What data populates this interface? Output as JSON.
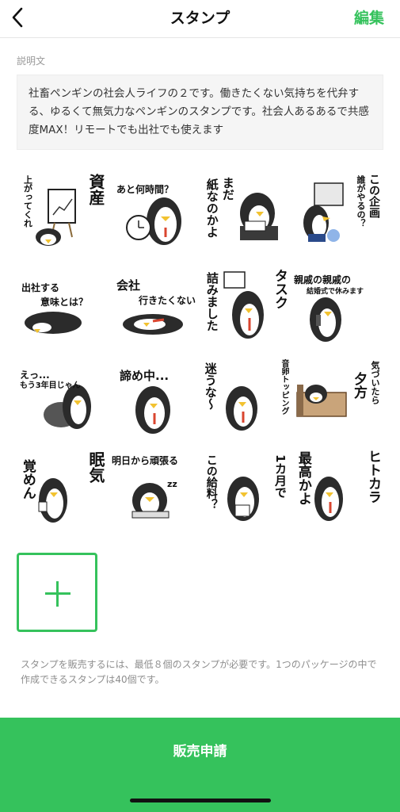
{
  "nav": {
    "title": "スタンプ",
    "edit_label": "編集",
    "back_icon": "chevron-left-icon"
  },
  "description": {
    "label": "説明文",
    "text": "社畜ペンギンの社会人ライフの２です。働きたくない気持ちを代弁する、ゆるくて無気力なペンギンのスタンプです。社会人あるあるで共感度MAX！リモートでも出社でも使えます"
  },
  "stickers": [
    {
      "t1": "資産",
      "t2": "上がってくれ"
    },
    {
      "t1": "あと何時間？",
      "t2": ""
    },
    {
      "t1": "まだ",
      "t2": "紙なのかよ"
    },
    {
      "t1": "この企画",
      "t2": "誰がやるの？"
    },
    {
      "t1": "出社する",
      "t2": "意味とは？"
    },
    {
      "t1": "会社",
      "t2": "行きたくない"
    },
    {
      "t1": "タスク",
      "t2": "詰みました"
    },
    {
      "t1": "親戚の親戚の",
      "t2": "結婚式で休みます"
    },
    {
      "t1": "えっ...",
      "t2": "もう3年目じゃん"
    },
    {
      "t1": "諦め中...",
      "t2": ""
    },
    {
      "t1": "迷うな〜",
      "t2": "音卵トッピング"
    },
    {
      "t1": "夕方",
      "t2": "気づいたら"
    },
    {
      "t1": "眠気",
      "t2": "覚めん"
    },
    {
      "t1": "明日から頑張る",
      "t2": "zz"
    },
    {
      "t1": "1カ月で",
      "t2": "この給料？"
    },
    {
      "t1": "ヒトカラ",
      "t2": "最高かよ"
    }
  ],
  "add_button": {
    "icon": "plus-icon"
  },
  "notice": "スタンプを販売するには、最低８個のスタンプが必要です。1つのパッケージの中で作成できるスタンプは40個です。",
  "sell_button": {
    "label": "販売申請"
  },
  "colors": {
    "accent": "#35c25c",
    "penguin_body": "#2b2b2b",
    "tie": "#d9452f"
  }
}
